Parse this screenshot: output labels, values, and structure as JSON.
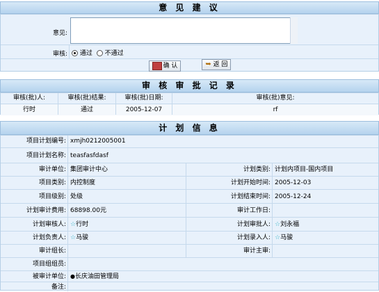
{
  "opinion": {
    "title": "意 见 建 议",
    "opinion_label": "意见:",
    "opinion_value": "",
    "audit_label": "审核:",
    "options": [
      "通过",
      "不通过"
    ],
    "selected": "通过",
    "confirm_label": "确 认",
    "back_label": "返 回"
  },
  "records": {
    "title": "审 核 审 批 记 录",
    "columns": [
      "审核(批)人:",
      "审核(批)结果:",
      "审核(批)日期:",
      "审核(批)意见:"
    ],
    "rows": [
      {
        "person": "行时",
        "result": "通过",
        "date": "2005-12-07",
        "opinion": "rf"
      }
    ]
  },
  "plan": {
    "title": "计 划 信 息",
    "plan_no_label": "项目计划编号:",
    "plan_no": "xmjh0212005001",
    "plan_name_label": "项目计划名称:",
    "plan_name": "teasfasfdasf",
    "audit_unit_label": "审计单位:",
    "audit_unit": "集团审计中心",
    "plan_category_label": "计划类别:",
    "plan_category": "计划内项目-国内项目",
    "project_type_label": "项目类别:",
    "project_type": "内控制度",
    "start_label": "计划开始时间:",
    "start": "2005-12-03",
    "level_label": "项目级别:",
    "level": "处级",
    "end_label": "计划结束时间:",
    "end": "2005-12-24",
    "cost_label": "计划审计费用:",
    "cost": "68898.00元",
    "workdays_label": "审计工作日:",
    "workdays": "",
    "checker_label": "计划审核人:",
    "checker": "行时",
    "approver_label": "计划审批人:",
    "approver": "刘永福",
    "owner_label": "计划负责人:",
    "owner": "马骏",
    "entry_label": "计划录入人:",
    "entry": "马骏",
    "team_leader_label": "审计组长:",
    "team_leader": "",
    "chief_label": "审计主审:",
    "chief": "",
    "members_label": "项目组组员:",
    "members": "",
    "audited_unit_label": "被审计单位:",
    "audited_unit": "长庆油田管理局",
    "remark_label": "备注:",
    "remark": ""
  }
}
